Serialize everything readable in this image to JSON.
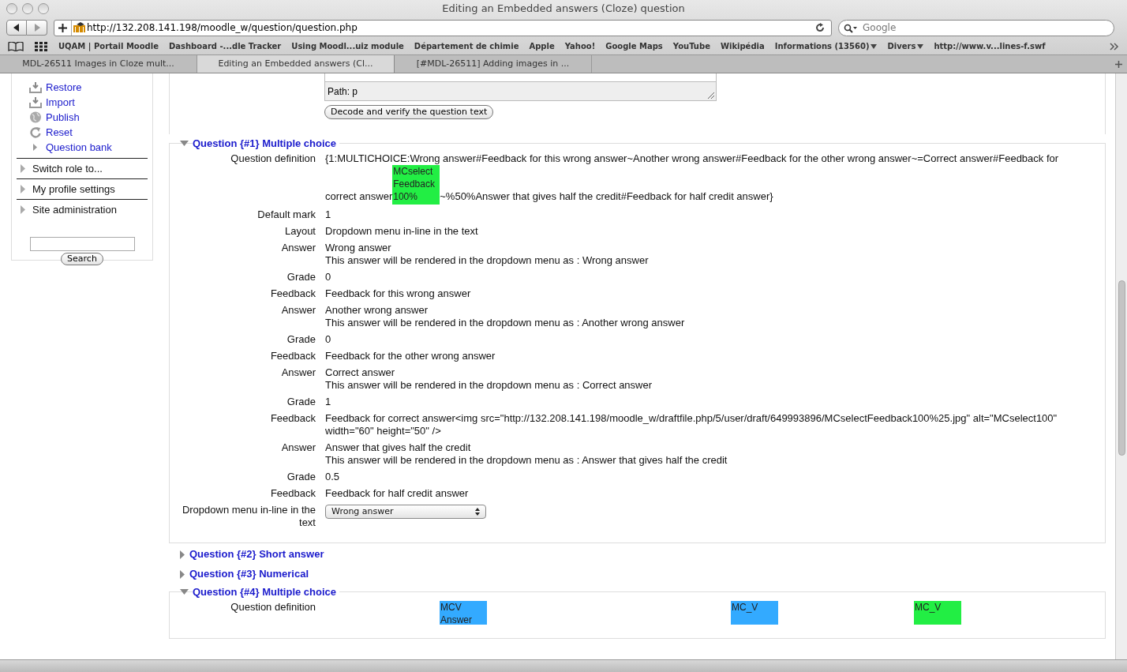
{
  "window": {
    "title": "Editing an Embedded answers (Cloze) question"
  },
  "toolbar": {
    "url": "http://132.208.141.198/moodle_w/question/question.php",
    "search_placeholder": "Google"
  },
  "bookmarks": [
    {
      "label": "UQAM | Portail Moodle",
      "menu": false
    },
    {
      "label": "Dashboard -...dle Tracker",
      "menu": false
    },
    {
      "label": "Using Moodl...uiz module",
      "menu": false
    },
    {
      "label": "Département de chimie",
      "menu": false
    },
    {
      "label": "Apple",
      "menu": false
    },
    {
      "label": "Yahoo!",
      "menu": false
    },
    {
      "label": "Google Maps",
      "menu": false
    },
    {
      "label": "YouTube",
      "menu": false
    },
    {
      "label": "Wikipédia",
      "menu": false
    },
    {
      "label": "Informations (13560)",
      "menu": true
    },
    {
      "label": "Divers",
      "menu": true
    },
    {
      "label": "http://www.v...lines-f.swf",
      "menu": false
    }
  ],
  "tabs": [
    {
      "label": "MDL-26511 Images in Cloze mult...",
      "selected": false
    },
    {
      "label": "Editing an Embedded answers (Cl...",
      "selected": true
    },
    {
      "label": "[#MDL-26511] Adding images in ...",
      "selected": false
    }
  ],
  "sidebar": {
    "links": [
      {
        "label": "Restore",
        "kind": "download"
      },
      {
        "label": "Import",
        "kind": "download"
      },
      {
        "label": "Publish",
        "kind": "globe"
      },
      {
        "label": "Reset",
        "kind": "reset"
      },
      {
        "label": "Question bank",
        "kind": "expander"
      }
    ],
    "sections": [
      "Switch role to...",
      "My profile settings",
      "Site administration"
    ],
    "search_button": "Search"
  },
  "editor": {
    "path": "Path: p",
    "button": "Decode and verify the question text"
  },
  "questions": [
    {
      "title": "Question {#1} Multiple choice",
      "expanded": true,
      "rows": [
        {
          "label": "Question definition",
          "kind": "definition",
          "parts": [
            {
              "kind": "line",
              "text": "{1:MULTICHOICE:Wrong answer#Feedback for this wrong answer~Another wrong answer#Feedback for the other wrong answer~=Correct answer#Feedback for"
            },
            {
              "kind": "text",
              "text": "correct answer"
            },
            {
              "kind": "image",
              "text": "MCselect Feedback 100%",
              "color": "#22ee44"
            },
            {
              "kind": "text",
              "text": "~%50%Answer that gives half the credit#Feedback for half credit answer}"
            }
          ]
        },
        {
          "label": "Default mark",
          "kind": "text",
          "lines": [
            "1"
          ]
        },
        {
          "label": "Layout",
          "kind": "text",
          "lines": [
            "Dropdown menu in-line in the text"
          ]
        },
        {
          "label": "Answer",
          "kind": "text",
          "lines": [
            "Wrong answer",
            "This answer will be rendered in the dropdown menu as : Wrong answer"
          ]
        },
        {
          "label": "Grade",
          "kind": "text",
          "lines": [
            "0"
          ]
        },
        {
          "label": "Feedback",
          "kind": "text",
          "lines": [
            "Feedback for this wrong answer"
          ]
        },
        {
          "label": "Answer",
          "kind": "text",
          "lines": [
            "Another wrong answer",
            "This answer will be rendered in the dropdown menu as : Another wrong answer"
          ]
        },
        {
          "label": "Grade",
          "kind": "text",
          "lines": [
            "0"
          ]
        },
        {
          "label": "Feedback",
          "kind": "text",
          "lines": [
            "Feedback for the other wrong answer"
          ]
        },
        {
          "label": "Answer",
          "kind": "text",
          "lines": [
            "Correct answer",
            "This answer will be rendered in the dropdown menu as : Correct answer"
          ]
        },
        {
          "label": "Grade",
          "kind": "text",
          "lines": [
            "1"
          ]
        },
        {
          "label": "Feedback",
          "kind": "text",
          "lines": [
            "Feedback for correct answer<img src=\"http://132.208.141.198/moodle_w/draftfile.php/5/user/draft/649993896/MCselectFeedback100%25.jpg\" alt=\"MCselect100\" width=\"60\" height=\"50\" />"
          ]
        },
        {
          "label": "Answer",
          "kind": "text",
          "lines": [
            "Answer that gives half the credit",
            "This answer will be rendered in the dropdown menu as : Answer that gives half the credit"
          ]
        },
        {
          "label": "Grade",
          "kind": "text",
          "lines": [
            "0.5"
          ]
        },
        {
          "label": "Feedback",
          "kind": "text",
          "lines": [
            "Feedback for half credit answer"
          ]
        },
        {
          "label": "Dropdown menu in-line in the text",
          "kind": "select",
          "value": "Wrong answer"
        }
      ]
    },
    {
      "title": "Question {#2} Short answer",
      "expanded": false
    },
    {
      "title": "Question {#3} Numerical",
      "expanded": false
    },
    {
      "title": "Question {#4} Multiple choice",
      "expanded": true,
      "rows": [
        {
          "label": "Question definition",
          "kind": "spread",
          "parts": [
            {
              "kind": "image",
              "text": "MCV Answer",
              "color": "#33aaff"
            },
            {
              "kind": "image",
              "text": "MC_V",
              "color": "#33aaff"
            },
            {
              "kind": "image",
              "text": "MC_V",
              "color": "#22ee44"
            }
          ]
        }
      ]
    }
  ]
}
